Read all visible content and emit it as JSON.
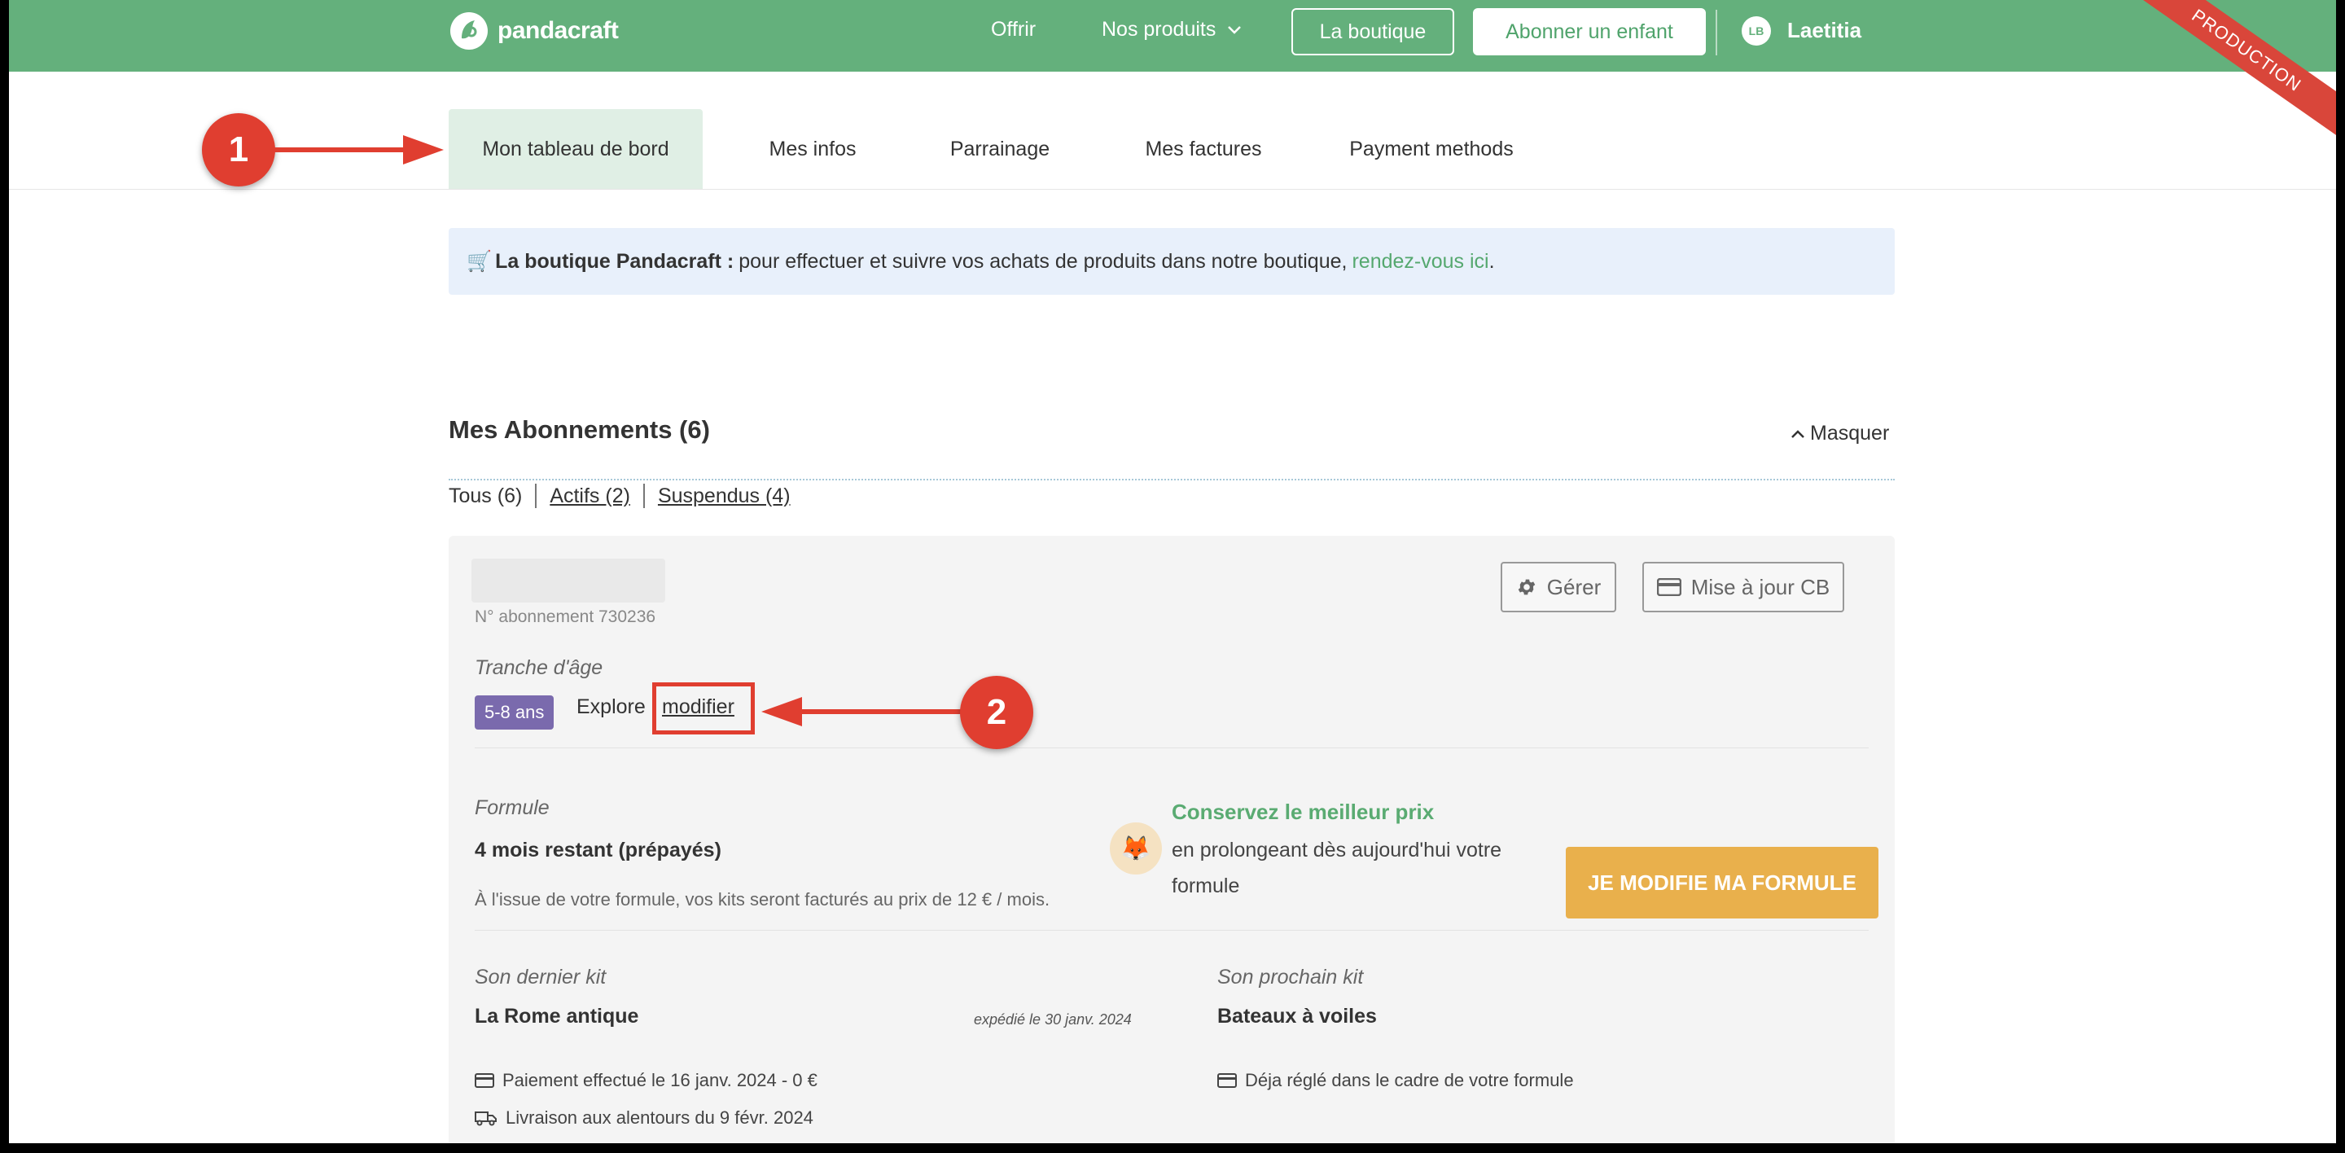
{
  "header": {
    "logo_text": "pandacraft",
    "nav": {
      "offrir": "Offrir",
      "nos_produits": "Nos produits",
      "la_boutique": "La boutique",
      "abonner": "Abonner un enfant"
    },
    "user": {
      "initials": "LB",
      "name": "Laetitia"
    },
    "ribbon": "PRODUCTION"
  },
  "tabs": [
    {
      "label": "Mon tableau de bord",
      "active": true
    },
    {
      "label": "Mes infos"
    },
    {
      "label": "Parrainage"
    },
    {
      "label": "Mes factures"
    },
    {
      "label": "Payment methods"
    }
  ],
  "banner": {
    "emoji": "🛒",
    "bold": "La boutique Pandacraft :",
    "text": "pour effectuer et suivre vos achats de produits dans notre boutique,",
    "link": "rendez-vous ici",
    "end": "."
  },
  "subscriptions": {
    "title": "Mes Abonnements (6)",
    "toggle": "Masquer",
    "filters": [
      "Tous (6)",
      "Actifs (2)",
      "Suspendus (4)"
    ]
  },
  "card": {
    "sub_number": "N° abonnement 730236",
    "buttons": {
      "gerer": "Gérer",
      "cb": "Mise à jour CB"
    },
    "age_label": "Tranche d'âge",
    "age_badge": "5-8 ans",
    "age_value": "Explore",
    "modifier": "modifier",
    "formule_label": "Formule",
    "formule_value": "4 mois restant (prépayés)",
    "formule_note": "À l'issue de votre formule, vos kits seront facturés au prix de 12 € / mois.",
    "promo_title": "Conservez le meilleur prix",
    "promo_text": "en prolongeant dès aujourd'hui votre formule",
    "cta": "JE MODIFIE MA FORMULE",
    "last_kit_label": "Son dernier kit",
    "last_kit_value": "La Rome antique",
    "last_kit_shipped": "expédié le 30 janv. 2024",
    "next_kit_label": "Son prochain kit",
    "next_kit_value": "Bateaux à voiles",
    "payment": "Paiement effectué le 16 janv. 2024 - 0 €",
    "delivery": "Livraison aux alentours du 9 févr. 2024",
    "next_payment": "Déja réglé dans le cadre de votre formule"
  },
  "annotations": [
    "1",
    "2"
  ],
  "colors": {
    "brand_green": "#64b07c",
    "annotation_red": "#e03e30",
    "cta_orange": "#e9b04c",
    "badge_purple": "#7a6aad"
  }
}
